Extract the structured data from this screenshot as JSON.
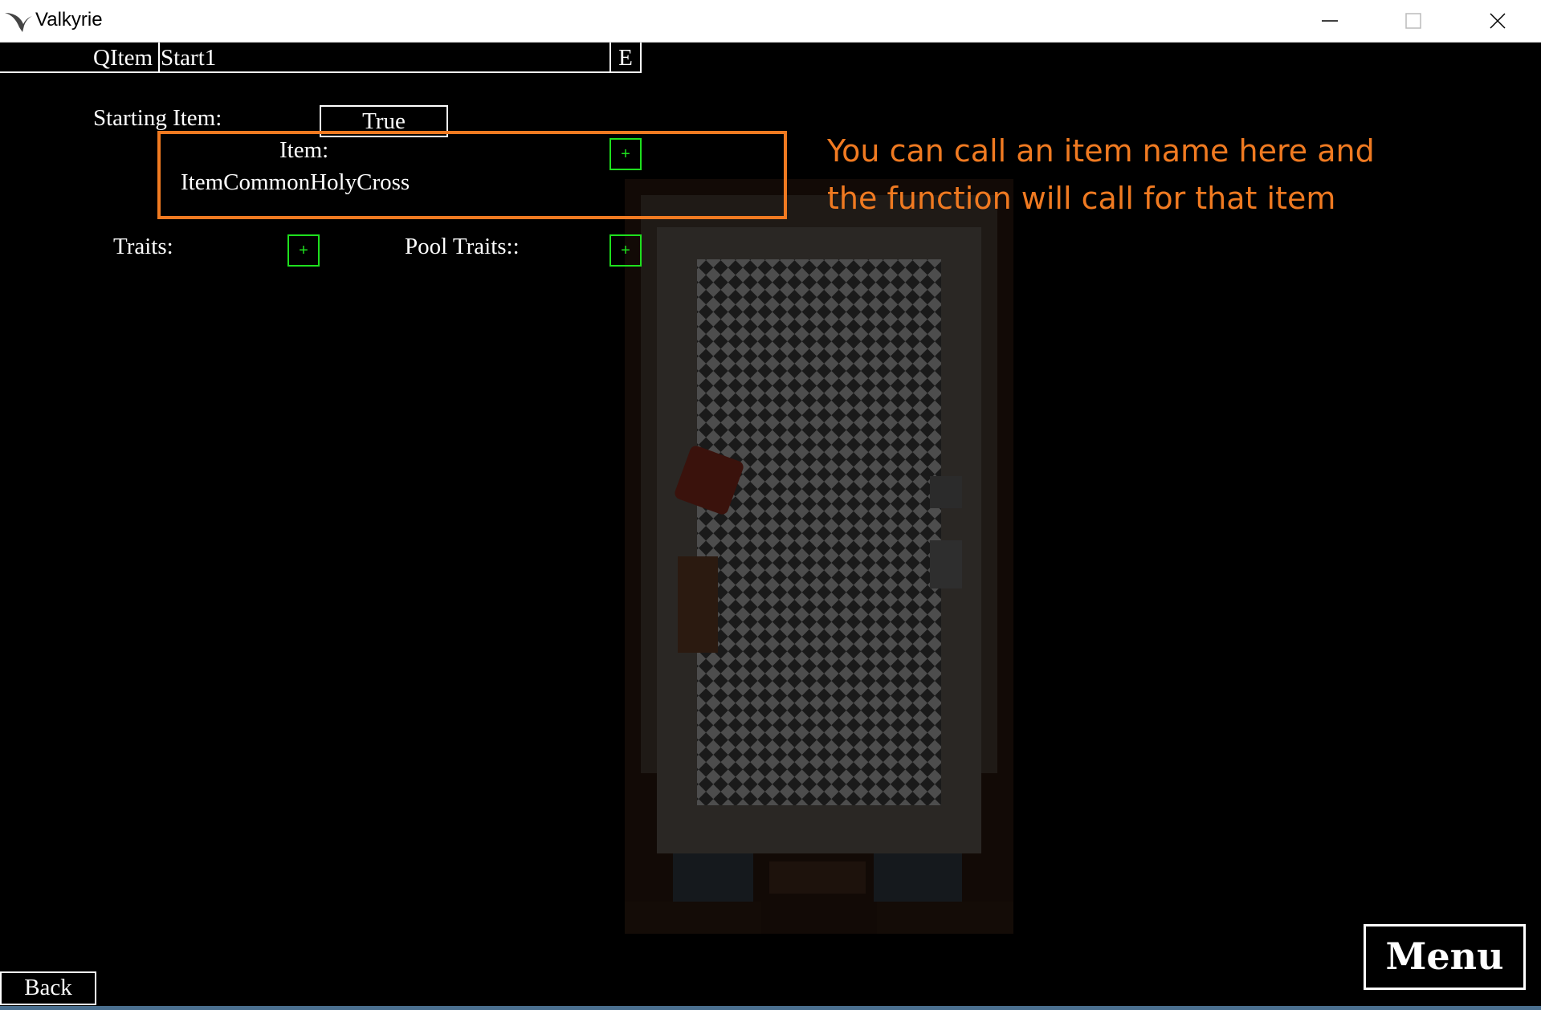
{
  "window": {
    "title": "Valkyrie",
    "app_icon": "valkyrie-wing-icon",
    "controls": [
      "minimize-icon",
      "maximize-icon",
      "close-icon"
    ]
  },
  "editor": {
    "name_prefix": "QItem",
    "name_value": "Start1",
    "edit_label": "E",
    "starting_item_label": "Starting Item:",
    "starting_item_value": "True",
    "item_label": "Item:",
    "item_value": "ItemCommonHolyCross",
    "traits_label": "Traits:",
    "pool_traits_label": "Pool Traits::",
    "add_symbol": "+"
  },
  "annotation": {
    "line1": "You can call an item name here and",
    "line2": "the function will call for that item",
    "color": "#f07a21"
  },
  "footer": {
    "back_label": "Back",
    "menu_label": "Menu"
  },
  "colors": {
    "add_button": "#1ee01e",
    "accent": "#f07a21"
  }
}
